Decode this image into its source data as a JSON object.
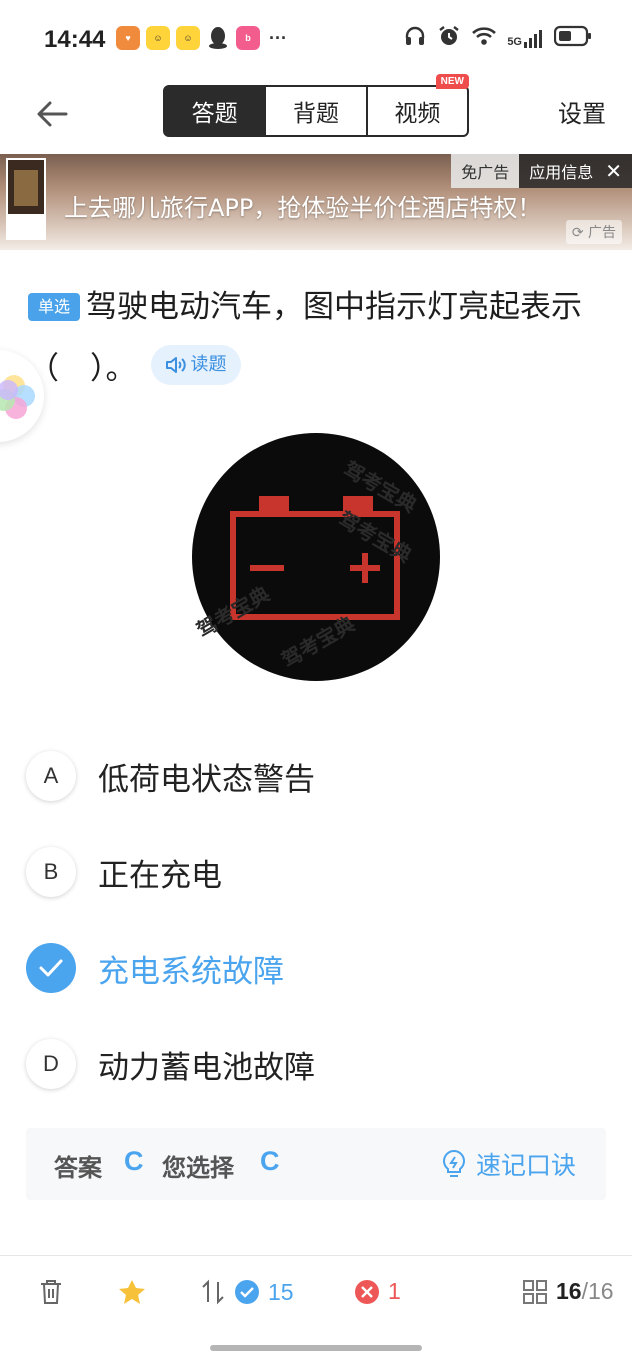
{
  "status": {
    "time": "14:44",
    "network": "5G"
  },
  "header": {
    "tabs": [
      {
        "label": "答题",
        "active": true
      },
      {
        "label": "背题",
        "active": false
      },
      {
        "label": "视频",
        "active": false,
        "badge": "NEW"
      }
    ],
    "settings_label": "设置"
  },
  "ad": {
    "free_label": "免广告",
    "info_label": "应用信息",
    "close_glyph": "✕",
    "text": "上去哪儿旅行APP，抢体验半价住酒店特权！",
    "ad_label": "广告"
  },
  "question": {
    "type_label": "单选",
    "text": "驾驶电动汽车，图中指示灯亮起表示（　）。",
    "read_label": "读题",
    "image_watermark": "驾考宝典"
  },
  "options": [
    {
      "key": "A",
      "text": "低荷电状态警告",
      "selected": false
    },
    {
      "key": "B",
      "text": "正在充电",
      "selected": false
    },
    {
      "key": "C",
      "text": "充电系统故障",
      "selected": true
    },
    {
      "key": "D",
      "text": "动力蓄电池故障",
      "selected": false
    }
  ],
  "answer": {
    "answer_label": "答案",
    "answer_value": "C",
    "chosen_label": "您选择",
    "chosen_value": "C",
    "mnemonic_label": "速记口诀"
  },
  "bottom": {
    "correct_count": "15",
    "wrong_count": "1",
    "page_current": "16",
    "page_total": "/16"
  },
  "colors": {
    "accent": "#4ba4ee",
    "wrong": "#ee5757",
    "signal_red": "#c8352d"
  }
}
